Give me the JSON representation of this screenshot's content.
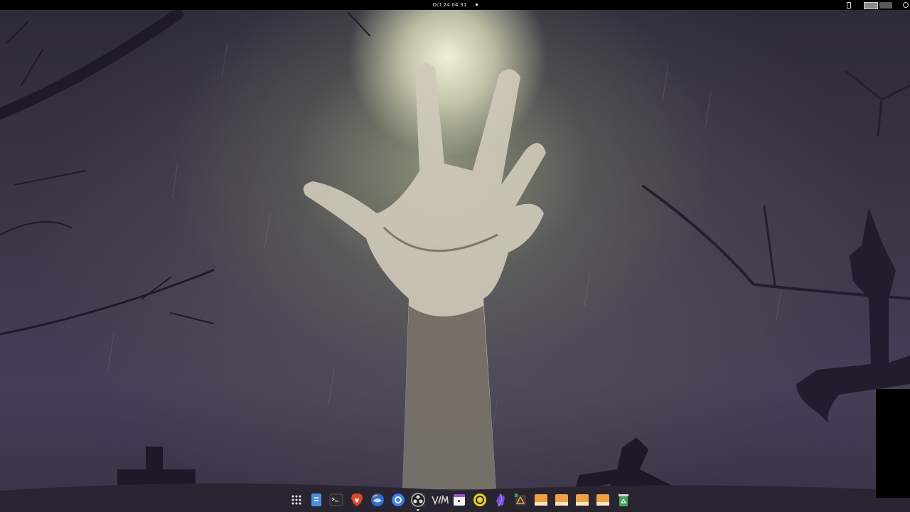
{
  "topbar": {
    "clock": "Oct 24  04:31"
  },
  "icons": {
    "phone": "phone-icon",
    "workspace_1": "workspace-thumbnail-icon",
    "workspace_2": "workspace-thumbnail-icon",
    "system": "power-icon"
  },
  "dock": {
    "items": [
      {
        "name": "app-grid-button",
        "icon": "app-grid-icon"
      },
      {
        "name": "files-button",
        "icon": "files-icon"
      },
      {
        "name": "terminal-button",
        "icon": "terminal-icon"
      },
      {
        "name": "brave-browser-button",
        "icon": "brave-lion-icon"
      },
      {
        "name": "thunderbird-button",
        "icon": "thunderbird-icon"
      },
      {
        "name": "chat-app-button",
        "icon": "chat-bubble-icon"
      },
      {
        "name": "obs-studio-button",
        "icon": "obs-icon"
      },
      {
        "name": "vim-button",
        "icon": "vim-icon"
      },
      {
        "name": "calendar-button",
        "icon": "calendar-icon"
      },
      {
        "name": "disk-app-button",
        "icon": "disk-icon"
      },
      {
        "name": "obsidian-button",
        "icon": "obsidian-gem-icon"
      },
      {
        "name": "builder-button",
        "icon": "builder-icon"
      },
      {
        "name": "folder-1-button",
        "icon": "folder-icon"
      },
      {
        "name": "folder-2-button",
        "icon": "folder-icon"
      },
      {
        "name": "folder-3-button",
        "icon": "folder-icon"
      },
      {
        "name": "folder-4-button",
        "icon": "folder-icon"
      },
      {
        "name": "trash-button",
        "icon": "recycle-bin-icon"
      }
    ]
  },
  "colors": {
    "topbar_bg": "#000000",
    "dock_bg": "#28262f",
    "folder_orange": "#f0a040",
    "brave_orange": "#e0462a",
    "thunderbird_blue": "#2b6fd6",
    "obsidian_purple": "#7c4dd8",
    "trash_green": "#3ca35a"
  },
  "wallpaper": {
    "description": "zombie-hand-graveyard"
  }
}
